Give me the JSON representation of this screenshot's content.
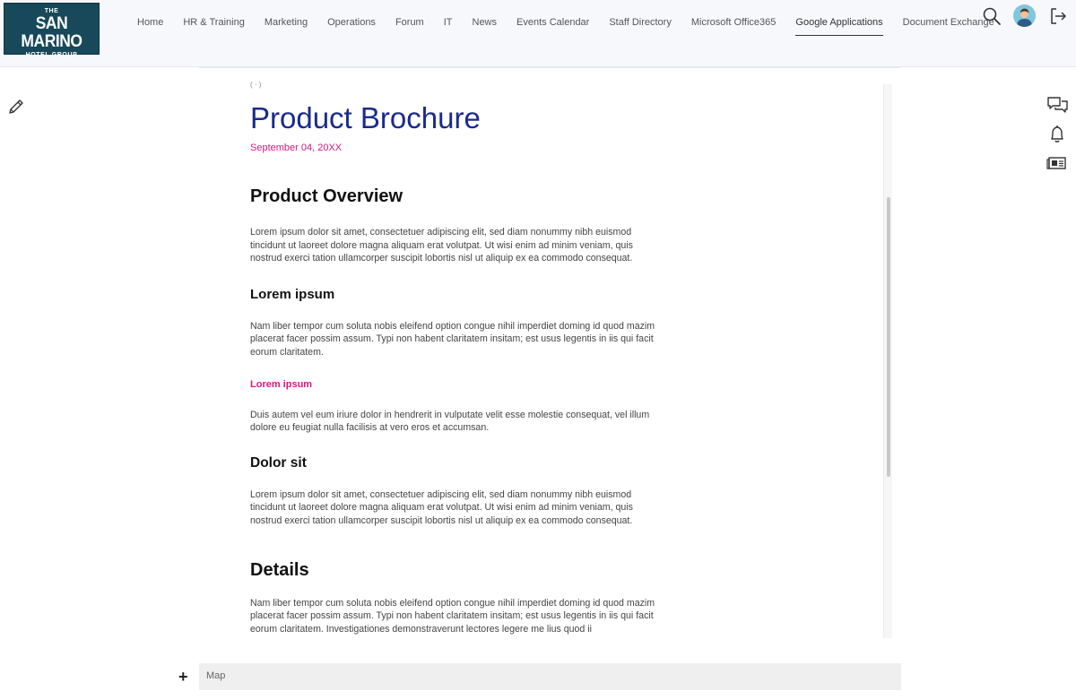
{
  "logo": {
    "line1": "THE",
    "line2": "SAN MARINO",
    "line3": "HOTEL GROUP"
  },
  "nav": {
    "items": [
      {
        "label": "Home"
      },
      {
        "label": "HR & Training"
      },
      {
        "label": "Marketing"
      },
      {
        "label": "Operations"
      },
      {
        "label": "Forum"
      },
      {
        "label": "IT"
      },
      {
        "label": "News"
      },
      {
        "label": "Events Calendar"
      },
      {
        "label": "Staff Directory"
      },
      {
        "label": "Microsoft Office365"
      },
      {
        "label": "Google Applications"
      },
      {
        "label": "Document Exchange"
      }
    ],
    "active": "Google Applications"
  },
  "header_icons": [
    "search-icon",
    "avatar",
    "logout-icon"
  ],
  "side_icons": [
    "pencil-icon",
    "chat-icon",
    "bell-icon",
    "newspaper-icon"
  ],
  "article": {
    "crumb": "( · )",
    "title": "Product Brochure",
    "date": "September 04, 20XX",
    "sections": {
      "overview_heading": "Product Overview",
      "overview_text": "Lorem ipsum dolor sit amet, consectetuer adipiscing elit, sed diam nonummy nibh euismod tincidunt ut laoreet dolore magna aliquam erat volutpat. Ut wisi enim ad minim veniam, quis nostrud exerci tation ullamcorper suscipit lobortis nisl ut aliquip ex ea commodo consequat.",
      "lorem_heading": "Lorem ipsum",
      "lorem_text": "Nam liber tempor cum soluta nobis eleifend option congue nihil imperdiet doming id quod mazim placerat facer possim assum. Typi non habent claritatem insitam; est usus legentis in iis qui facit eorum claritatem.",
      "lorem_pink_heading": "Lorem ipsum",
      "lorem_pink_text": "Duis autem vel eum iriure dolor in hendrerit in vulputate velit esse molestie consequat, vel illum dolore eu feugiat nulla facilisis at vero eros et accumsan.",
      "dolor_heading": "Dolor sit",
      "dolor_text": "Lorem ipsum dolor sit amet, consectetuer adipiscing elit, sed diam nonummy nibh euismod tincidunt ut laoreet dolore magna aliquam erat volutpat. Ut wisi enim ad minim veniam, quis nostrud exerci tation ullamcorper suscipit lobortis nisl ut aliquip ex ea commodo consequat.",
      "details_heading": "Details",
      "details_text": "Nam liber tempor cum soluta nobis eleifend option congue nihil imperdiet doming id quod mazim placerat facer possim assum. Typi non habent claritatem insitam; est usus legentis in iis qui facit eorum claritatem. Investigationes demonstraverunt lectores legere me lius quod ii"
    }
  },
  "bottom": {
    "plus": "+",
    "map_label": "Map"
  },
  "colors": {
    "title": "#1b2a8c",
    "accent": "#d4197d",
    "logo_bg": "#17495a"
  }
}
